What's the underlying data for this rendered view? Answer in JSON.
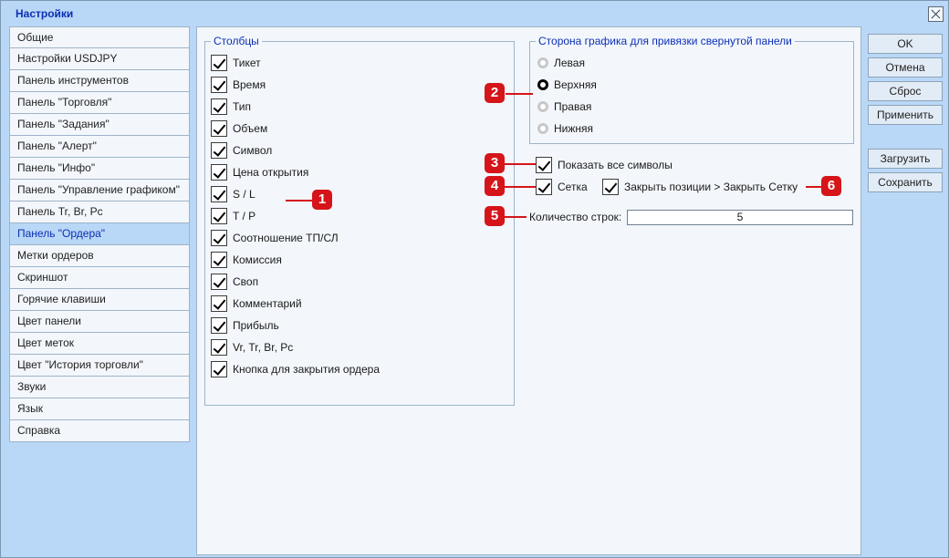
{
  "window": {
    "title": "Настройки"
  },
  "sidebar": {
    "items": [
      {
        "label": "Общие"
      },
      {
        "label": "Настройки USDJPY"
      },
      {
        "label": "Панель инструментов"
      },
      {
        "label": "Панель \"Торговля\""
      },
      {
        "label": "Панель \"Задания\""
      },
      {
        "label": "Панель \"Алерт\""
      },
      {
        "label": "Панель \"Инфо\""
      },
      {
        "label": "Панель \"Управление графиком\""
      },
      {
        "label": "Панель Tr, Br, Pc"
      },
      {
        "label": "Панель \"Ордера\"",
        "active": true
      },
      {
        "label": "Метки ордеров"
      },
      {
        "label": "Скриншот"
      },
      {
        "label": "Горячие клавиши"
      },
      {
        "label": "Цвет панели"
      },
      {
        "label": "Цвет меток"
      },
      {
        "label": "Цвет \"История торговли\""
      },
      {
        "label": "Звуки"
      },
      {
        "label": "Язык"
      },
      {
        "label": "Справка"
      }
    ]
  },
  "columns_group": {
    "title": "Столбцы",
    "items": [
      {
        "label": "Тикет",
        "checked": true
      },
      {
        "label": "Время",
        "checked": true
      },
      {
        "label": "Тип",
        "checked": true
      },
      {
        "label": "Объем",
        "checked": true
      },
      {
        "label": "Символ",
        "checked": true
      },
      {
        "label": "Цена открытия",
        "checked": true
      },
      {
        "label": "S / L",
        "checked": true
      },
      {
        "label": "T / P",
        "checked": true
      },
      {
        "label": "Соотношение ТП/СЛ",
        "checked": true
      },
      {
        "label": "Комиссия",
        "checked": true
      },
      {
        "label": "Своп",
        "checked": true
      },
      {
        "label": "Комментарий",
        "checked": true
      },
      {
        "label": "Прибыль",
        "checked": true
      },
      {
        "label": "Vr, Tr, Br, Pc",
        "checked": true
      },
      {
        "label": "Кнопка для закрытия ордера",
        "checked": true
      }
    ]
  },
  "side_group": {
    "title": "Сторона графика для привязки свернутой панели",
    "options": [
      {
        "label": "Левая",
        "selected": false
      },
      {
        "label": "Верхняя",
        "selected": true
      },
      {
        "label": "Правая",
        "selected": false
      },
      {
        "label": "Нижняя",
        "selected": false
      }
    ]
  },
  "options": {
    "show_all_symbols": "Показать все символы",
    "grid": "Сетка",
    "close_positions": "Закрыть позиции > Закрыть Сетку",
    "rows_label": "Количество строк:",
    "rows_value": "5"
  },
  "buttons": {
    "ok": "OK",
    "cancel": "Отмена",
    "reset": "Сброс",
    "apply": "Применить",
    "load": "Загрузить",
    "save": "Сохранить"
  },
  "markers": [
    "1",
    "2",
    "3",
    "4",
    "5",
    "6"
  ],
  "colors": {
    "accent": "#0b2fb5",
    "background": "#b9d7f6",
    "marker": "#d5151a"
  }
}
